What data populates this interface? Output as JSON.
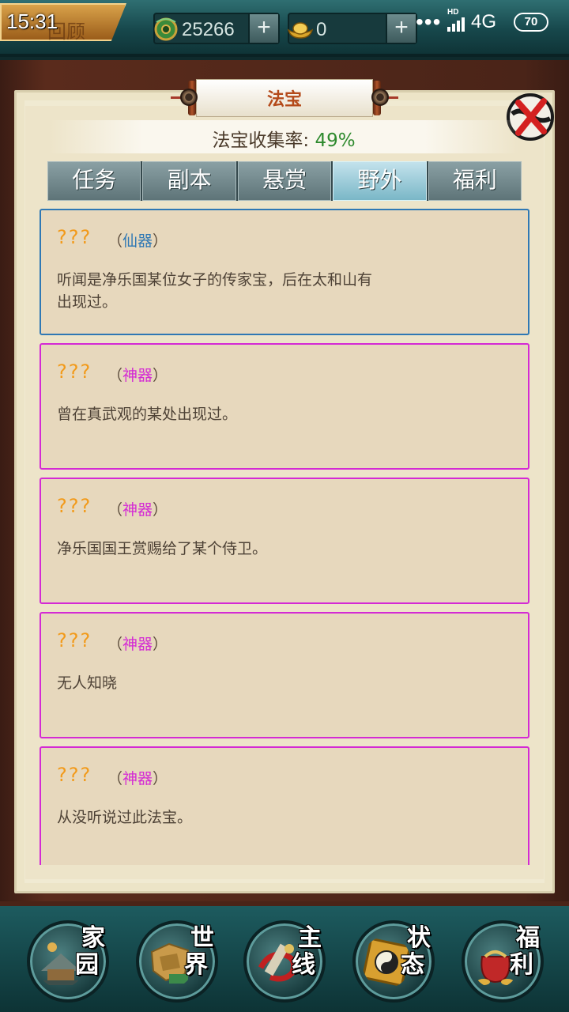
{
  "status_bar": {
    "time": "15:31",
    "network": "4G",
    "hd_badge": "HD",
    "battery": "70",
    "dots": "•••"
  },
  "header": {
    "back_label": "回顾",
    "jade_amount": "25266",
    "gold_amount": "0",
    "plus_label": "+"
  },
  "panel": {
    "title": "法宝",
    "collect_label": "法宝收集率: ",
    "collect_value": "49%"
  },
  "tabs": [
    {
      "label": "任务",
      "active": false
    },
    {
      "label": "副本",
      "active": false
    },
    {
      "label": "悬赏",
      "active": false
    },
    {
      "label": "野外",
      "active": true
    },
    {
      "label": "福利",
      "active": false
    }
  ],
  "items": [
    {
      "name": "???",
      "grade_open": "（",
      "grade": "仙器",
      "grade_close": "）",
      "description": "听闻是净乐国某位女子的传家宝，后在太和山有出现过。",
      "border_color": "#2f78b4"
    },
    {
      "name": "???",
      "grade_open": "（",
      "grade": "神器",
      "grade_close": "）",
      "description": "曾在真武观的某处出现过。",
      "border_color": "#d42ad4"
    },
    {
      "name": "???",
      "grade_open": "（",
      "grade": "神器",
      "grade_close": "）",
      "description": "净乐国国王赏赐给了某个侍卫。",
      "border_color": "#d42ad4"
    },
    {
      "name": "???",
      "grade_open": "（",
      "grade": "神器",
      "grade_close": "）",
      "description": "无人知晓",
      "border_color": "#d42ad4"
    },
    {
      "name": "???",
      "grade_open": "（",
      "grade": "神器",
      "grade_close": "）",
      "description": "从没听说过此法宝。",
      "border_color": "#d42ad4"
    }
  ],
  "bottom_nav": [
    {
      "label_top": "家",
      "label_bottom": "园",
      "icon": "home-icon"
    },
    {
      "label_top": "世",
      "label_bottom": "界",
      "icon": "world-map-icon"
    },
    {
      "label_top": "主",
      "label_bottom": "线",
      "icon": "main-quest-icon"
    },
    {
      "label_top": "状",
      "label_bottom": "态",
      "icon": "bagua-status-icon"
    },
    {
      "label_top": "福",
      "label_bottom": "利",
      "icon": "gift-bag-icon"
    }
  ],
  "colors": {
    "immortal_grade": "#2f78b4",
    "divine_grade": "#d42ad4",
    "item_name": "#f29a1a",
    "collect_value": "#2e8a2e",
    "title_text": "#b44a1a"
  }
}
